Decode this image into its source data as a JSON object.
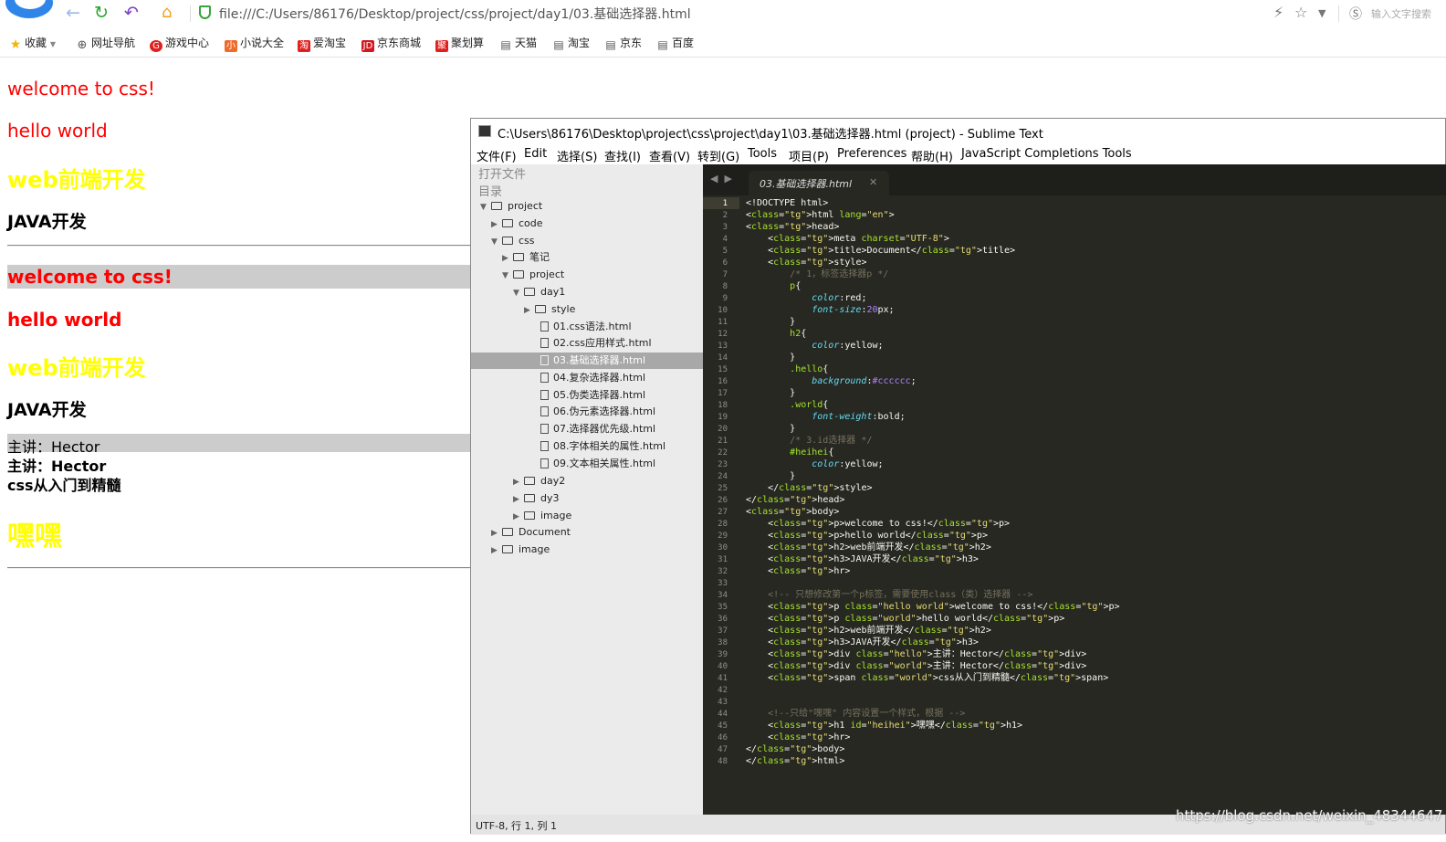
{
  "browser": {
    "url": "file:///C:/Users/86176/Desktop/project/css/project/day1/03.基础选择器.html",
    "search_placeholder": "输入文字搜索",
    "bookmarks": [
      "收藏",
      "网址导航",
      "游戏中心",
      "小说大全",
      "爱淘宝",
      "京东商城",
      "聚划算",
      "天猫",
      "淘宝",
      "京东",
      "百度"
    ],
    "colors": {
      "accent": "#2f86e8",
      "secure": "#3aa33a"
    }
  },
  "page": {
    "p1": "welcome to css!",
    "p2": "hello world",
    "h2a": "web前端开发",
    "h3a": "JAVA开发",
    "p3": "welcome to css!",
    "p4": "hello world",
    "h2b": "web前端开发",
    "h3b": "JAVA开发",
    "div1": "主讲：Hector",
    "div2": "主讲：Hector",
    "span": "css从入门到精髓",
    "h1": "嘿嘿",
    "colors": {
      "red": "#ff0000",
      "yellow": "#ffff00",
      "hello_bg": "#cccccc"
    }
  },
  "sublime": {
    "title": "C:\\Users\\86176\\Desktop\\project\\css\\project\\day1\\03.基础选择器.html (project) - Sublime Text",
    "menu": [
      "文件(F)",
      "Edit",
      "选择(S)",
      "查找(I)",
      "查看(V)",
      "转到(G)",
      "Tools",
      "项目(P)",
      "Preferences",
      "帮助(H)",
      "JavaScript Completions Tools"
    ],
    "sidebar": {
      "open_files": "打开文件",
      "folders": "目录",
      "tree": [
        "project",
        "code",
        "css",
        "笔记",
        "project",
        "day1",
        "style",
        "01.css语法.html",
        "02.css应用样式.html",
        "03.基础选择器.html",
        "04.复杂选择器.html",
        "05.伪类选择器.html",
        "06.伪元素选择器.html",
        "07.选择器优先级.html",
        "08.字体相关的属性.html",
        "09.文本相关属性.html",
        "day2",
        "dy3",
        "image",
        "Document",
        "image"
      ]
    },
    "tab": "03.基础选择器.html",
    "status": "UTF-8, 行 1, 列 1",
    "code_lines": [
      "<!DOCTYPE html>",
      "<html lang=\"en\">",
      "<head>",
      "    <meta charset=\"UTF-8\">",
      "    <title>Document</title>",
      "    <style>",
      "        /* 1，标签选择器p */",
      "        p{",
      "            color:red;",
      "            font-size:20px;",
      "        }",
      "        h2{",
      "            color:yellow;",
      "        }",
      "        .hello{",
      "            background:#cccccc;",
      "        }",
      "        .world{",
      "            font-weight:bold;",
      "        }",
      "        /* 3.id选择器 */",
      "        #heihei{",
      "            color:yellow;",
      "        }",
      "    </style>",
      "</head>",
      "<body>",
      "    <p>welcome to css!</p>",
      "    <p>hello world</p>",
      "    <h2>web前端开发</h2>",
      "    <h3>JAVA开发</h3>",
      "    <hr>",
      "",
      "    <!-- 只想修改第一个p标签，需要使用class（类）选择器 -->",
      "    <p class=\"hello world\">welcome to css!</p>",
      "    <p class=\"world\">hello world</p>",
      "    <h2>web前端开发</h2>",
      "    <h3>JAVA开发</h3>",
      "    <div class=\"hello\">主讲：Hector</div>",
      "    <div class=\"world\">主讲：Hector</div>",
      "    <span class=\"world\">css从入门到精髓</span>",
      "",
      "",
      "    <!--只给\"嘿嘿\" 内容设置一个样式，根据 -->",
      "    <h1 id=\"heihei\">嘿嘿</h1>",
      "    <hr>",
      "</body>",
      "</html>"
    ]
  },
  "watermark": "https://blog.csdn.net/weixin_48344647"
}
